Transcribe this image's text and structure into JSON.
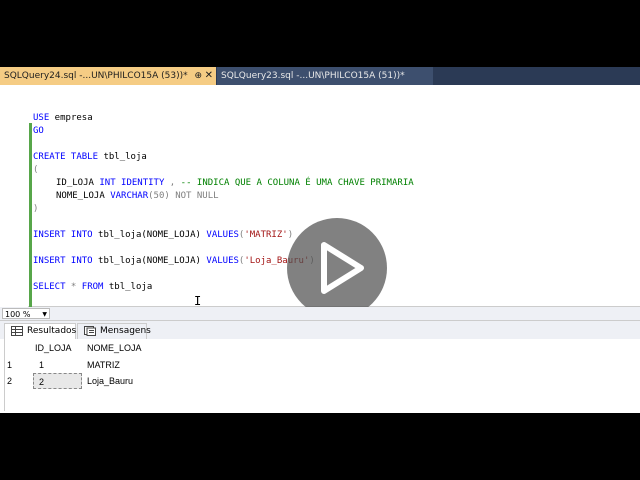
{
  "tabs": [
    {
      "label": "SQLQuery24.sql -...UN\\PHILCO15A (53))*",
      "pin": "⊕",
      "close": "✕"
    },
    {
      "label": "SQLQuery23.sql -...UN\\PHILCO15A (51))*"
    }
  ],
  "code": {
    "l1_kw": "USE",
    "l1_rest": " empresa",
    "l2": "GO",
    "l3_kw": "CREATE TABLE",
    "l3_rest": " tbl_loja",
    "l4": "(",
    "l5_a": "ID_LOJA ",
    "l5_kw": "INT IDENTITY",
    "l5_b": " , ",
    "l5_comment": "-- INDICA QUE A COLUNA É UMA CHAVE PRIMARIA",
    "l6_a": "NOME_LOJA ",
    "l6_kw": "VARCHAR",
    "l6_b": "(50) ",
    "l6_gray": "NOT NULL",
    "l7": ")",
    "l8_kw1": "INSERT INTO",
    "l8_a": " tbl_loja(NOME_LOJA) ",
    "l8_kw2": "VALUES",
    "l8_b": "(",
    "l8_str": "'MATRIZ'",
    "l8_c": ")",
    "l9_kw1": "INSERT INTO",
    "l9_a": " tbl_loja(NOME_LOJA) ",
    "l9_kw2": "VALUES",
    "l9_b": "(",
    "l9_str": "'Loja_Bauru'",
    "l9_c": ")",
    "l10_kw1": "SELECT",
    "l10_a": " * ",
    "l10_kw2": "FROM",
    "l10_b": " tbl_loja"
  },
  "zoom": {
    "value": "100 %",
    "arrow": "▼"
  },
  "results_tabs": {
    "results": "Resultados",
    "messages": "Mensagens"
  },
  "grid": {
    "columns": [
      "ID_LOJA",
      "NOME_LOJA"
    ],
    "rows": [
      {
        "num": "1",
        "id": "1",
        "nome": "MATRIZ"
      },
      {
        "num": "2",
        "id": "2",
        "nome": "Loja_Bauru"
      }
    ]
  },
  "colors": {
    "active_tab": "#f5cc84",
    "tabbar": "#2b3a55",
    "keyword": "#0000ff",
    "comment": "#008000",
    "string": "#a31515"
  }
}
